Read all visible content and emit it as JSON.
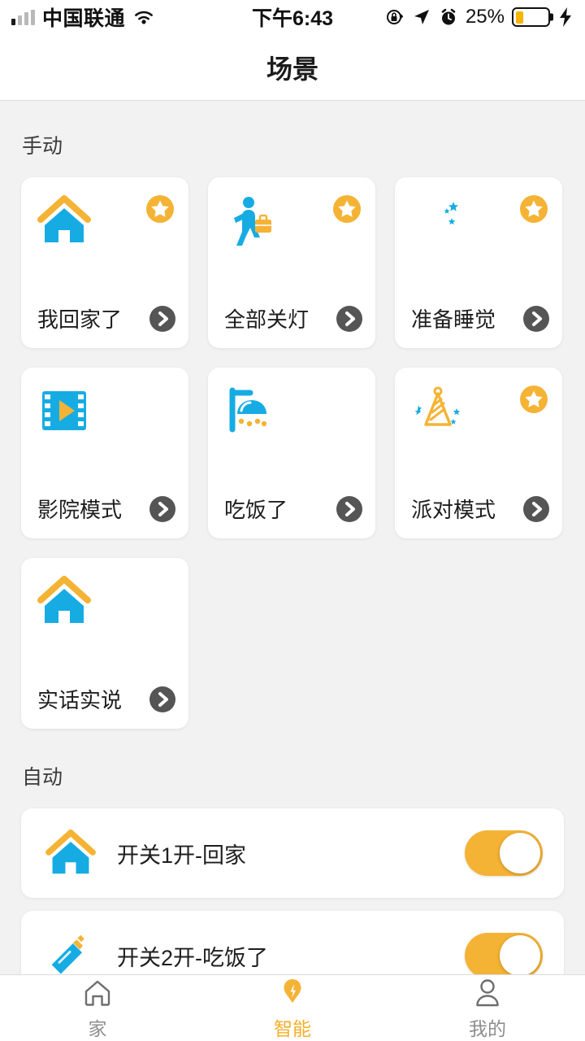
{
  "status_bar": {
    "carrier": "中国联通",
    "time": "下午6:43",
    "battery_percent": "25%",
    "battery_level": 25,
    "icons": [
      "signal-bars-icon",
      "wifi-icon",
      "rotation-lock-icon",
      "location-arrow-icon",
      "alarm-clock-icon",
      "battery-icon",
      "charging-bolt-icon"
    ]
  },
  "header": {
    "title": "场景"
  },
  "sections": {
    "manual": {
      "title": "手动"
    },
    "automatic": {
      "title": "自动"
    }
  },
  "scenes": [
    {
      "label": "我回家了",
      "icon": "home-icon",
      "favorite": true
    },
    {
      "label": "全部关灯",
      "icon": "person-leaving-icon",
      "favorite": true
    },
    {
      "label": "准备睡觉",
      "icon": "moon-stars-icon",
      "favorite": true
    },
    {
      "label": "影院模式",
      "icon": "film-play-icon",
      "favorite": false
    },
    {
      "label": "吃饭了",
      "icon": "shower-icon",
      "favorite": false
    },
    {
      "label": "派对模式",
      "icon": "party-hat-icon",
      "favorite": true
    },
    {
      "label": "实话实说",
      "icon": "home-icon",
      "favorite": false
    }
  ],
  "automations": [
    {
      "label": "开关1开-回家",
      "icon": "home-icon",
      "enabled": true
    },
    {
      "label": "开关2开-吃饭了",
      "icon": "baby-bottle-icon",
      "enabled": true
    }
  ],
  "tabs": [
    {
      "label": "家",
      "icon": "home-outline-icon",
      "active": false
    },
    {
      "label": "智能",
      "icon": "smart-pin-icon",
      "active": true
    },
    {
      "label": "我的",
      "icon": "person-outline-icon",
      "active": false
    }
  ],
  "colors": {
    "accent_orange": "#f5b335",
    "accent_blue": "#16ace3",
    "page_background": "#f2f2f2",
    "card_background": "#ffffff",
    "arrow_gray": "#555555"
  }
}
